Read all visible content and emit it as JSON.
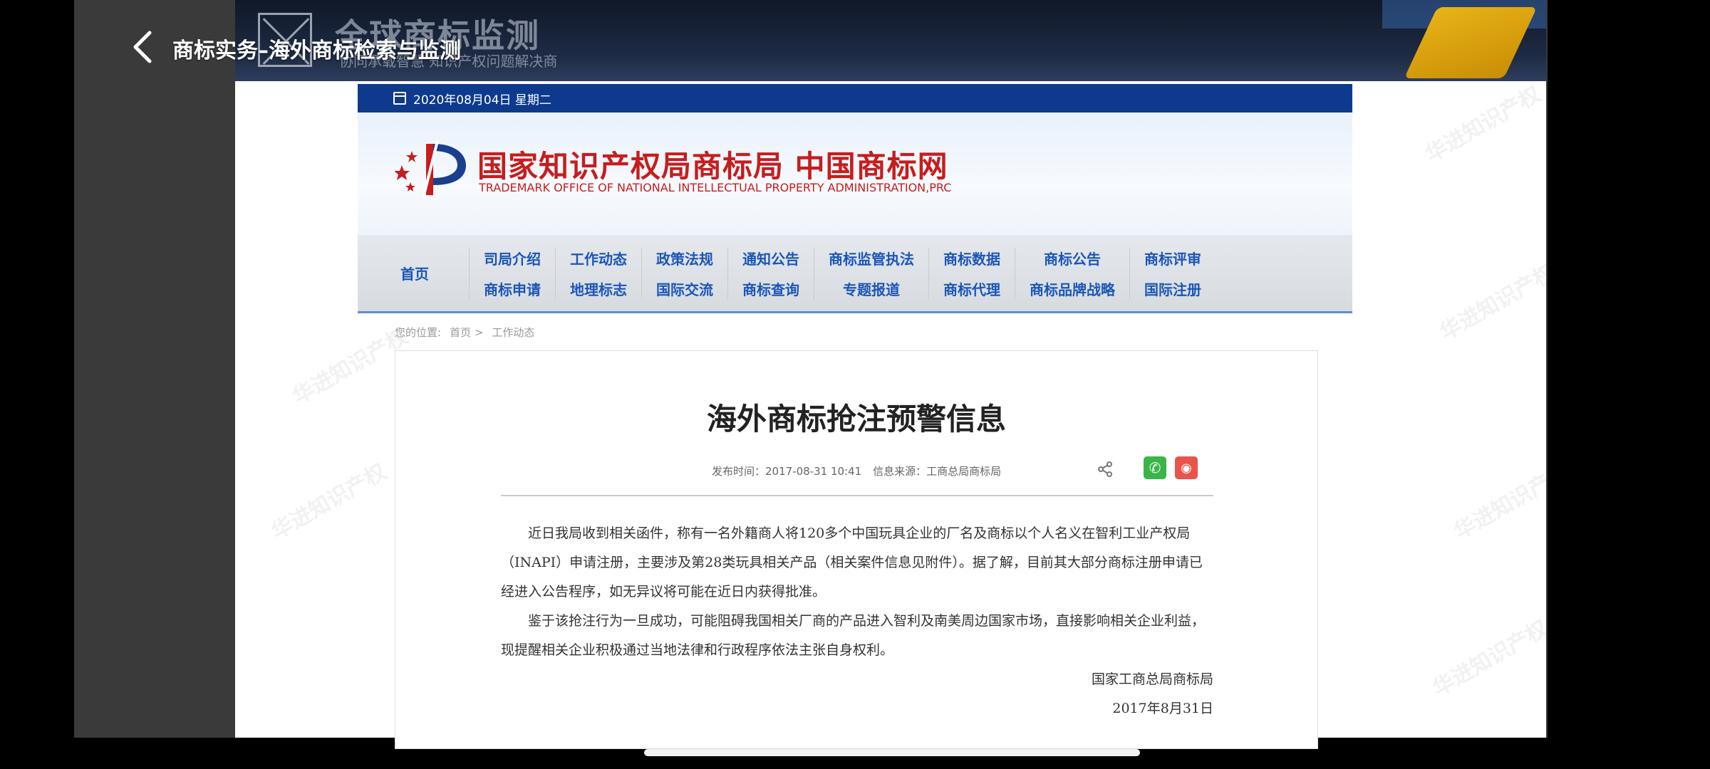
{
  "player": {
    "title": "商标实务–海外商标检索与监测",
    "back_icon": "back-arrow-icon"
  },
  "slide_header": {
    "brand_title": "全球商标监测",
    "brand_subtitle": "协同承载智慧 知识产权问题解决商"
  },
  "watermark": "华进知识产权",
  "site": {
    "date": "2020年08月04日 星期二",
    "banner_cn": "国家知识产权局商标局 中国商标网",
    "banner_en": "TRADEMARK OFFICE OF NATIONAL INTELLECTUAL PROPERTY ADMINISTRATION,PRC",
    "nav_home": "首页",
    "nav_columns": [
      [
        "司局介绍",
        "商标申请"
      ],
      [
        "工作动态",
        "地理标志"
      ],
      [
        "政策法规",
        "国际交流"
      ],
      [
        "通知公告",
        "商标查询"
      ],
      [
        "商标监管执法",
        "专题报道"
      ],
      [
        "商标数据",
        "商标代理"
      ],
      [
        "商标公告",
        "商标品牌战略"
      ],
      [
        "商标评审",
        "国际注册"
      ]
    ],
    "breadcrumb": {
      "label": "您的位置:",
      "home": "首页 >",
      "current": "工作动态"
    }
  },
  "article": {
    "title": "海外商标抢注预警信息",
    "publish_time": "发布时间：2017-08-31 10:41",
    "source": "信息来源：工商总局商标局",
    "paragraphs": [
      "近日我局收到相关函件，称有一名外籍商人将120多个中国玩具企业的厂名及商标以个人名义在智利工业产权局（INAPI）申请注册，主要涉及第28类玩具相关产品（相关案件信息见附件）。据了解，目前其大部分商标注册申请已经进入公告程序，如无异议将可能在近日内获得批准。",
      "鉴于该抢注行为一旦成功，可能阻碍我国相关厂商的产品进入智利及南美周边国家市场，直接影响相关企业利益，现提醒相关企业积极通过当地法律和行政程序依法主张自身权利。"
    ],
    "signature": "国家工商总局商标局",
    "sign_date": "2017年8月31日"
  },
  "colors": {
    "datebar": "#0d3a8c",
    "banner_red": "#c61d1d",
    "nav_blue": "#1a56b8",
    "wechat": "#3bb44a",
    "weibo": "#e8534a"
  }
}
